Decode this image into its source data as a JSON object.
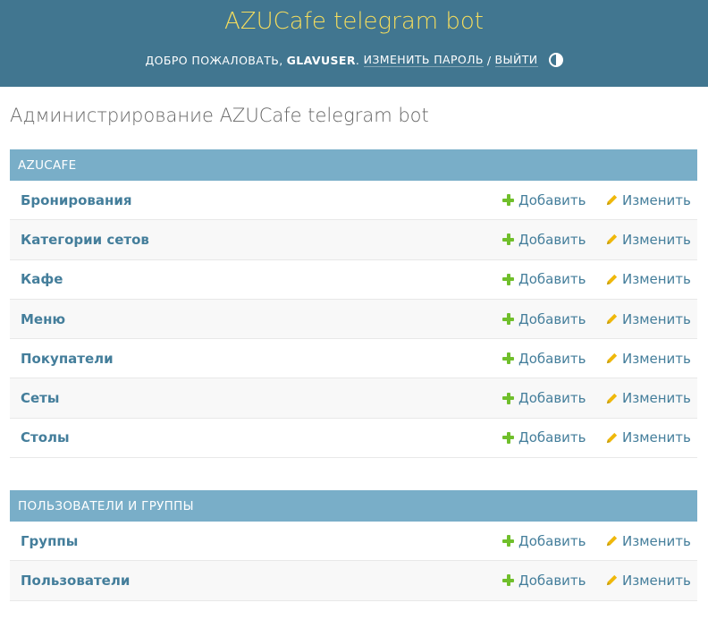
{
  "header": {
    "branding": "AZUCafe telegram bot",
    "user_tools": {
      "welcome": "Добро пожаловать,",
      "username": "glavuser",
      "change_password": "Изменить пароль",
      "separator": "/",
      "logout": "Выйти",
      "theme_toggle_icon": "half-circle-icon"
    }
  },
  "page_title": "Администрирование AZUCafe telegram bot",
  "colors": {
    "header_bg": "#417690",
    "branding": "#f5dd5d",
    "caption_bg": "#79aec8",
    "link": "#447e9b",
    "add_icon": "#70bf2b",
    "change_icon": "#efb80b"
  },
  "apps": [
    {
      "caption": "AZUCafe",
      "models": [
        {
          "name": "Бронирования",
          "add": "Добавить",
          "change": "Изменить"
        },
        {
          "name": "Категории сетов",
          "add": "Добавить",
          "change": "Изменить"
        },
        {
          "name": "Кафе",
          "add": "Добавить",
          "change": "Изменить"
        },
        {
          "name": "Меню",
          "add": "Добавить",
          "change": "Изменить"
        },
        {
          "name": "Покупатели",
          "add": "Добавить",
          "change": "Изменить"
        },
        {
          "name": "Сеты",
          "add": "Добавить",
          "change": "Изменить"
        },
        {
          "name": "Столы",
          "add": "Добавить",
          "change": "Изменить"
        }
      ]
    },
    {
      "caption": "Пользователи и группы",
      "models": [
        {
          "name": "Группы",
          "add": "Добавить",
          "change": "Изменить"
        },
        {
          "name": "Пользователи",
          "add": "Добавить",
          "change": "Изменить"
        }
      ]
    }
  ]
}
